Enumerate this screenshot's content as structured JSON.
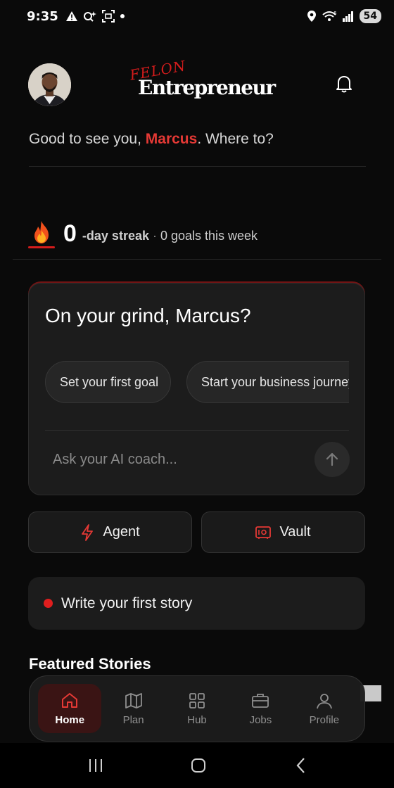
{
  "status_bar": {
    "time": "9:35",
    "battery": "54"
  },
  "header": {
    "logo_top": "FELON",
    "logo_main": "Entrepreneur"
  },
  "greeting": {
    "prefix": "Good to see you, ",
    "name": "Marcus",
    "suffix": ". Where to?"
  },
  "streak": {
    "count": "0",
    "label": "-day streak",
    "separator": "·",
    "goals": "0 goals this week"
  },
  "grind_card": {
    "title": "On your grind, Marcus?",
    "chips": [
      "Set your first goal",
      "Start your business journey"
    ],
    "input_placeholder": "Ask your AI coach..."
  },
  "actions": {
    "agent_label": "Agent",
    "vault_label": "Vault"
  },
  "story": {
    "label": "Write your first story"
  },
  "featured": {
    "title": "Featured Stories"
  },
  "bottom_nav": {
    "items": [
      {
        "label": "Home",
        "icon": "home-icon",
        "active": true
      },
      {
        "label": "Plan",
        "icon": "map-icon",
        "active": false
      },
      {
        "label": "Hub",
        "icon": "grid-icon",
        "active": false
      },
      {
        "label": "Jobs",
        "icon": "briefcase-icon",
        "active": false
      },
      {
        "label": "Profile",
        "icon": "person-icon",
        "active": false
      }
    ]
  },
  "colors": {
    "accent": "#e53935",
    "background": "#0a0a0a",
    "card": "#1c1c1c"
  }
}
